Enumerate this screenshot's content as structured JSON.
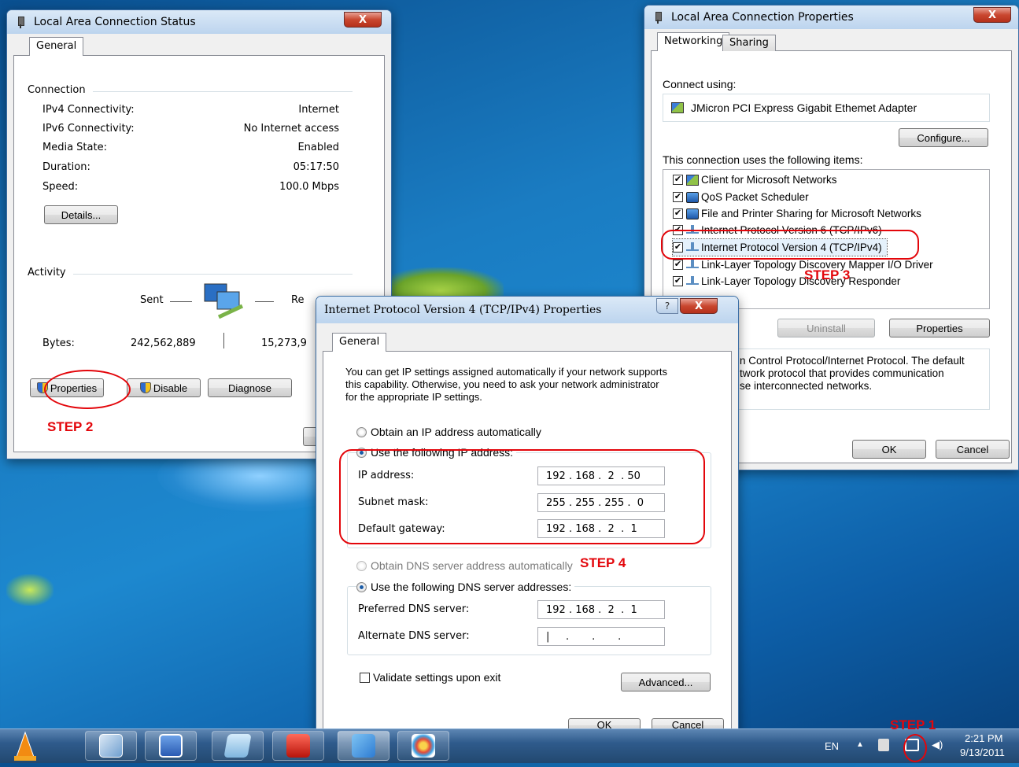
{
  "status_window": {
    "title": "Local Area Connection Status",
    "tab": "General",
    "connection_header": "Connection",
    "rows": [
      {
        "label": "IPv4 Connectivity:",
        "value": "Internet"
      },
      {
        "label": "IPv6 Connectivity:",
        "value": "No Internet access"
      },
      {
        "label": "Media State:",
        "value": "Enabled"
      },
      {
        "label": "Duration:",
        "value": "05:17:50"
      },
      {
        "label": "Speed:",
        "value": "100.0 Mbps"
      }
    ],
    "details_btn": "Details...",
    "activity_header": "Activity",
    "sent_label": "Sent",
    "received_label": "Re",
    "bytes_label": "Bytes:",
    "bytes_sent": "242,562,889",
    "bytes_received": "15,273,9",
    "properties_btn": "Properties",
    "disable_btn": "Disable",
    "diagnose_btn": "Diagnose"
  },
  "props_window": {
    "title": "Local Area Connection Properties",
    "tabs": [
      "Networking",
      "Sharing"
    ],
    "connect_using_label": "Connect using:",
    "adapter": "JMicron PCI Express Gigabit Ethemet Adapter",
    "configure_btn": "Configure...",
    "items_label": "This connection uses the following items:",
    "items": [
      "Client for Microsoft Networks",
      "QoS Packet Scheduler",
      "File and Printer Sharing for Microsoft Networks",
      "Internet Protocol Version 6 (TCP/IPv6)",
      "Internet Protocol Version 4 (TCP/IPv4)",
      "Link-Layer Topology Discovery Mapper I/O Driver",
      "Link-Layer Topology Discovery Responder"
    ],
    "uninstall_btn": "Uninstall",
    "properties_btn": "Properties",
    "description": "n Control Protocol/Internet Protocol. The default\ntwork protocol that provides communication\nse interconnected networks.",
    "ok_btn": "OK",
    "cancel_btn": "Cancel"
  },
  "ipv4_window": {
    "title": "Internet Protocol Version 4 (TCP/IPv4) Properties",
    "help_btn": "?",
    "close_btn": "X",
    "tab": "General",
    "intro": "You can get IP settings assigned automatically if your network supports\nthis capability. Otherwise, you need to ask your network administrator\nfor the appropriate IP settings.",
    "auto_ip": "Obtain an IP address automatically",
    "manual_ip": "Use the following IP address:",
    "ip_label": "IP address:",
    "ip_value": "192 . 168 .  2  . 50",
    "mask_label": "Subnet mask:",
    "mask_value": "255 . 255 . 255 .  0",
    "gateway_label": "Default gateway:",
    "gateway_value": "192 . 168 .  2  .  1",
    "auto_dns": "Obtain DNS server address automatically",
    "manual_dns": "Use the following DNS server addresses:",
    "pref_dns_label": "Preferred DNS server:",
    "pref_dns_value": "192 . 168 .  2  .  1",
    "alt_dns_label": "Alternate DNS server:",
    "alt_dns_value": "|     .       .       .",
    "validate": "Validate settings upon exit",
    "advanced_btn": "Advanced...",
    "ok_btn": "OK",
    "cancel_btn": "Cancel"
  },
  "annotations": {
    "step1": "STEP 1",
    "step2": "STEP 2",
    "step3": "STEP 3",
    "step4": "STEP 4",
    "color": "#e3060b"
  },
  "taskbar": {
    "language": "EN",
    "time": "2:21 PM",
    "date": "9/13/2011",
    "apps": [
      "vlc-icon",
      "virtualbox-icon",
      "word-icon",
      "notepad-icon",
      "acrobat-icon",
      "control-panel-icon",
      "paint-icon"
    ]
  }
}
